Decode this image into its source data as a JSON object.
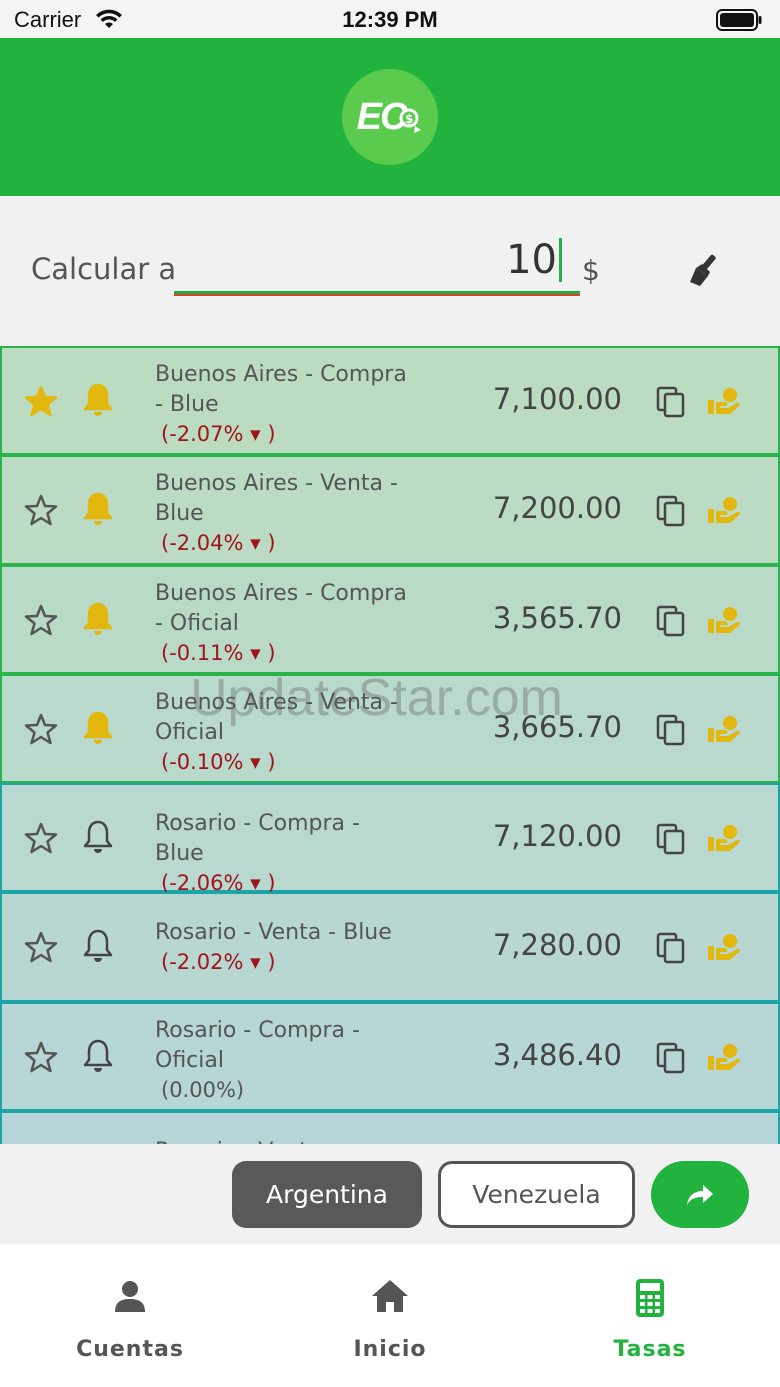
{
  "status_bar": {
    "carrier": "Carrier",
    "time": "12:39 PM"
  },
  "header": {
    "logo_text": "EC"
  },
  "calculator": {
    "label": "Calcular a",
    "amount": "10",
    "currency": "$"
  },
  "rates": [
    {
      "name": "Buenos Aires - Compra - Blue",
      "change": "(-2.07% ▾ )",
      "value": "7,100.00",
      "favorite": true,
      "alert": true,
      "trend": "down",
      "bg": "#bcdcc2"
    },
    {
      "name": "Buenos Aires - Venta - Blue",
      "change": "(-2.04% ▾ )",
      "value": "7,200.00",
      "favorite": false,
      "alert": true,
      "trend": "down",
      "bg": "#bbdbc5"
    },
    {
      "name": "Buenos Aires - Compra - Oficial",
      "change": "(-0.11% ▾ )",
      "value": "3,565.70",
      "favorite": false,
      "alert": true,
      "trend": "down",
      "bg": "#badac8"
    },
    {
      "name": "Buenos Aires - Venta - Oficial",
      "change": "(-0.10% ▾ )",
      "value": "3,665.70",
      "favorite": false,
      "alert": true,
      "trend": "down",
      "bg": "#b9d9cc"
    },
    {
      "name": "Rosario - Compra - Blue",
      "change": "(-2.06% ▾ )",
      "value": "7,120.00",
      "favorite": false,
      "alert": false,
      "trend": "down",
      "bg": "#b8d8d0"
    },
    {
      "name": "Rosario - Venta - Blue",
      "change": "(-2.02% ▾ )",
      "value": "7,280.00",
      "favorite": false,
      "alert": false,
      "trend": "down",
      "bg": "#b8d7d3"
    },
    {
      "name": "Rosario - Compra - Oficial",
      "change": "(0.00%)",
      "value": "3,486.40",
      "favorite": false,
      "alert": false,
      "trend": "flat",
      "bg": "#b7d6d6"
    },
    {
      "name": "Rosario - Venta -",
      "change": "",
      "value": "",
      "favorite": false,
      "alert": false,
      "trend": "flat",
      "bg": "#b6d5d8"
    }
  ],
  "country_buttons": {
    "argentina": "Argentina",
    "venezuela": "Venezuela"
  },
  "tabs": [
    {
      "label": "Cuentas",
      "icon": "person-icon",
      "active": false
    },
    {
      "label": "Inicio",
      "icon": "home-icon",
      "active": false
    },
    {
      "label": "Tasas",
      "icon": "calculator-icon",
      "active": true
    }
  ],
  "watermark": "UpdateStar.com",
  "colors": {
    "brand_green": "#22b33e",
    "gold": "#e2b80f",
    "negative": "#a0141b",
    "dark_button": "#595959"
  }
}
